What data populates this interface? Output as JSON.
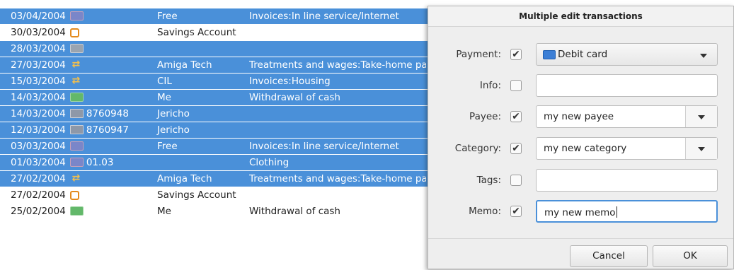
{
  "transactions": [
    {
      "date": "03/04/2004",
      "icon": "card-icon",
      "info": "",
      "payee": "Free",
      "category": "Invoices:In line service/Internet",
      "selected": true
    },
    {
      "date": "30/03/2004",
      "icon": "savings-icon",
      "info": "",
      "payee": "Savings Account",
      "category": "",
      "selected": false
    },
    {
      "date": "28/03/2004",
      "icon": "gray-card-icon",
      "info": "",
      "payee": "",
      "category": "",
      "selected": true
    },
    {
      "date": "27/03/2004",
      "icon": "transfer-icon",
      "info": "",
      "payee": "Amiga Tech",
      "category": "Treatments and wages:Take-home pay",
      "selected": true
    },
    {
      "date": "15/03/2004",
      "icon": "transfer-icon",
      "info": "",
      "payee": "CIL",
      "category": "Invoices:Housing",
      "selected": true
    },
    {
      "date": "14/03/2004",
      "icon": "cash-icon",
      "info": "",
      "payee": "Me",
      "category": "Withdrawal of cash",
      "selected": true
    },
    {
      "date": "14/03/2004",
      "icon": "cheque-icon",
      "info": "8760948",
      "payee": "Jericho",
      "category": "",
      "selected": true
    },
    {
      "date": "12/03/2004",
      "icon": "cheque-icon",
      "info": "8760947",
      "payee": "Jericho",
      "category": "",
      "selected": true
    },
    {
      "date": "03/03/2004",
      "icon": "card-icon",
      "info": "",
      "payee": "Free",
      "category": "Invoices:In line service/Internet",
      "selected": true
    },
    {
      "date": "01/03/2004",
      "icon": "card-icon",
      "info": "01.03",
      "payee": "",
      "category": "Clothing",
      "selected": true
    },
    {
      "date": "27/02/2004",
      "icon": "transfer-icon",
      "info": "",
      "payee": "Amiga Tech",
      "category": "Treatments and wages:Take-home pay",
      "selected": true
    },
    {
      "date": "27/02/2004",
      "icon": "savings-icon",
      "info": "",
      "payee": "Savings Account",
      "category": "",
      "selected": false
    },
    {
      "date": "25/02/2004",
      "icon": "cash-icon",
      "info": "",
      "payee": "Me",
      "category": "Withdrawal of cash",
      "selected": false
    }
  ],
  "dialog": {
    "title": "Multiple edit transactions",
    "fields": {
      "payment": {
        "label": "Payment:",
        "checked": true,
        "value": "Debit card"
      },
      "info": {
        "label": "Info:",
        "checked": false,
        "value": ""
      },
      "payee": {
        "label": "Payee:",
        "checked": true,
        "value": "my new payee"
      },
      "category": {
        "label": "Category:",
        "checked": true,
        "value": "my new category"
      },
      "tags": {
        "label": "Tags:",
        "checked": false,
        "value": ""
      },
      "memo": {
        "label": "Memo:",
        "checked": true,
        "value": "my new memo"
      }
    },
    "buttons": {
      "cancel": "Cancel",
      "ok": "OK"
    }
  },
  "colors": {
    "selection": "#4a90d9",
    "accent": "#4a90d9"
  },
  "checkmark_glyph": "✔"
}
